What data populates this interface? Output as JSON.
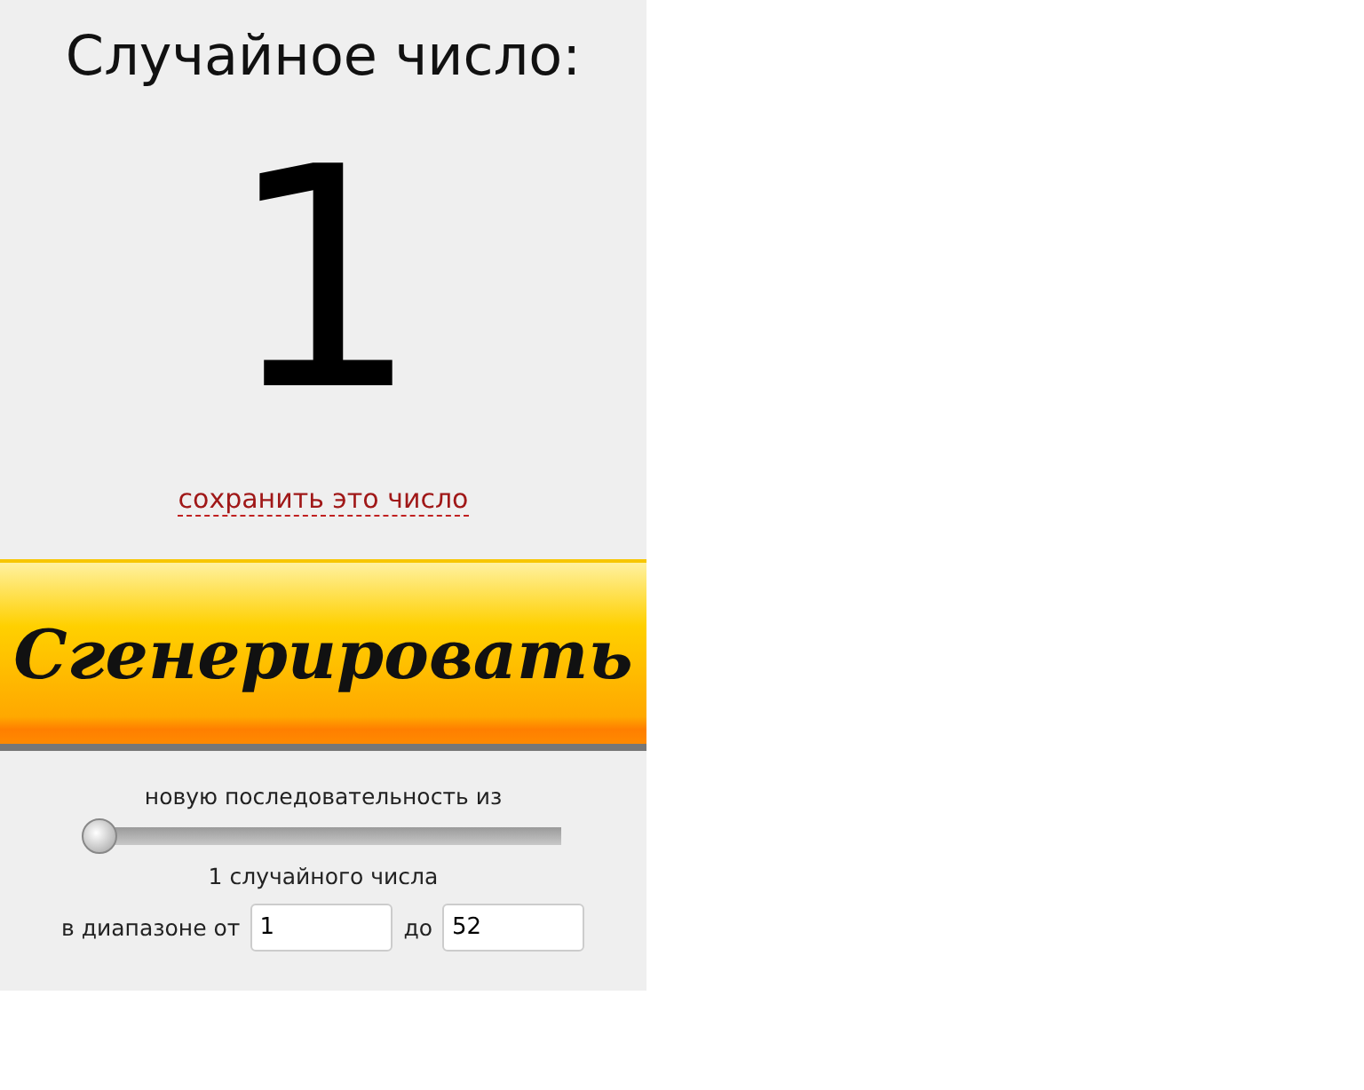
{
  "title": "Случайное число:",
  "result": "1",
  "save_link": "сохранить это число",
  "generate_button": "Сгенерировать",
  "sequence_label": "новую последовательность из",
  "count_slider": {
    "level": 0
  },
  "count_label": "1 случайного числа",
  "range": {
    "from_label": "в диапазоне от",
    "from_value": "1",
    "to_label": "до",
    "to_value": "52"
  }
}
